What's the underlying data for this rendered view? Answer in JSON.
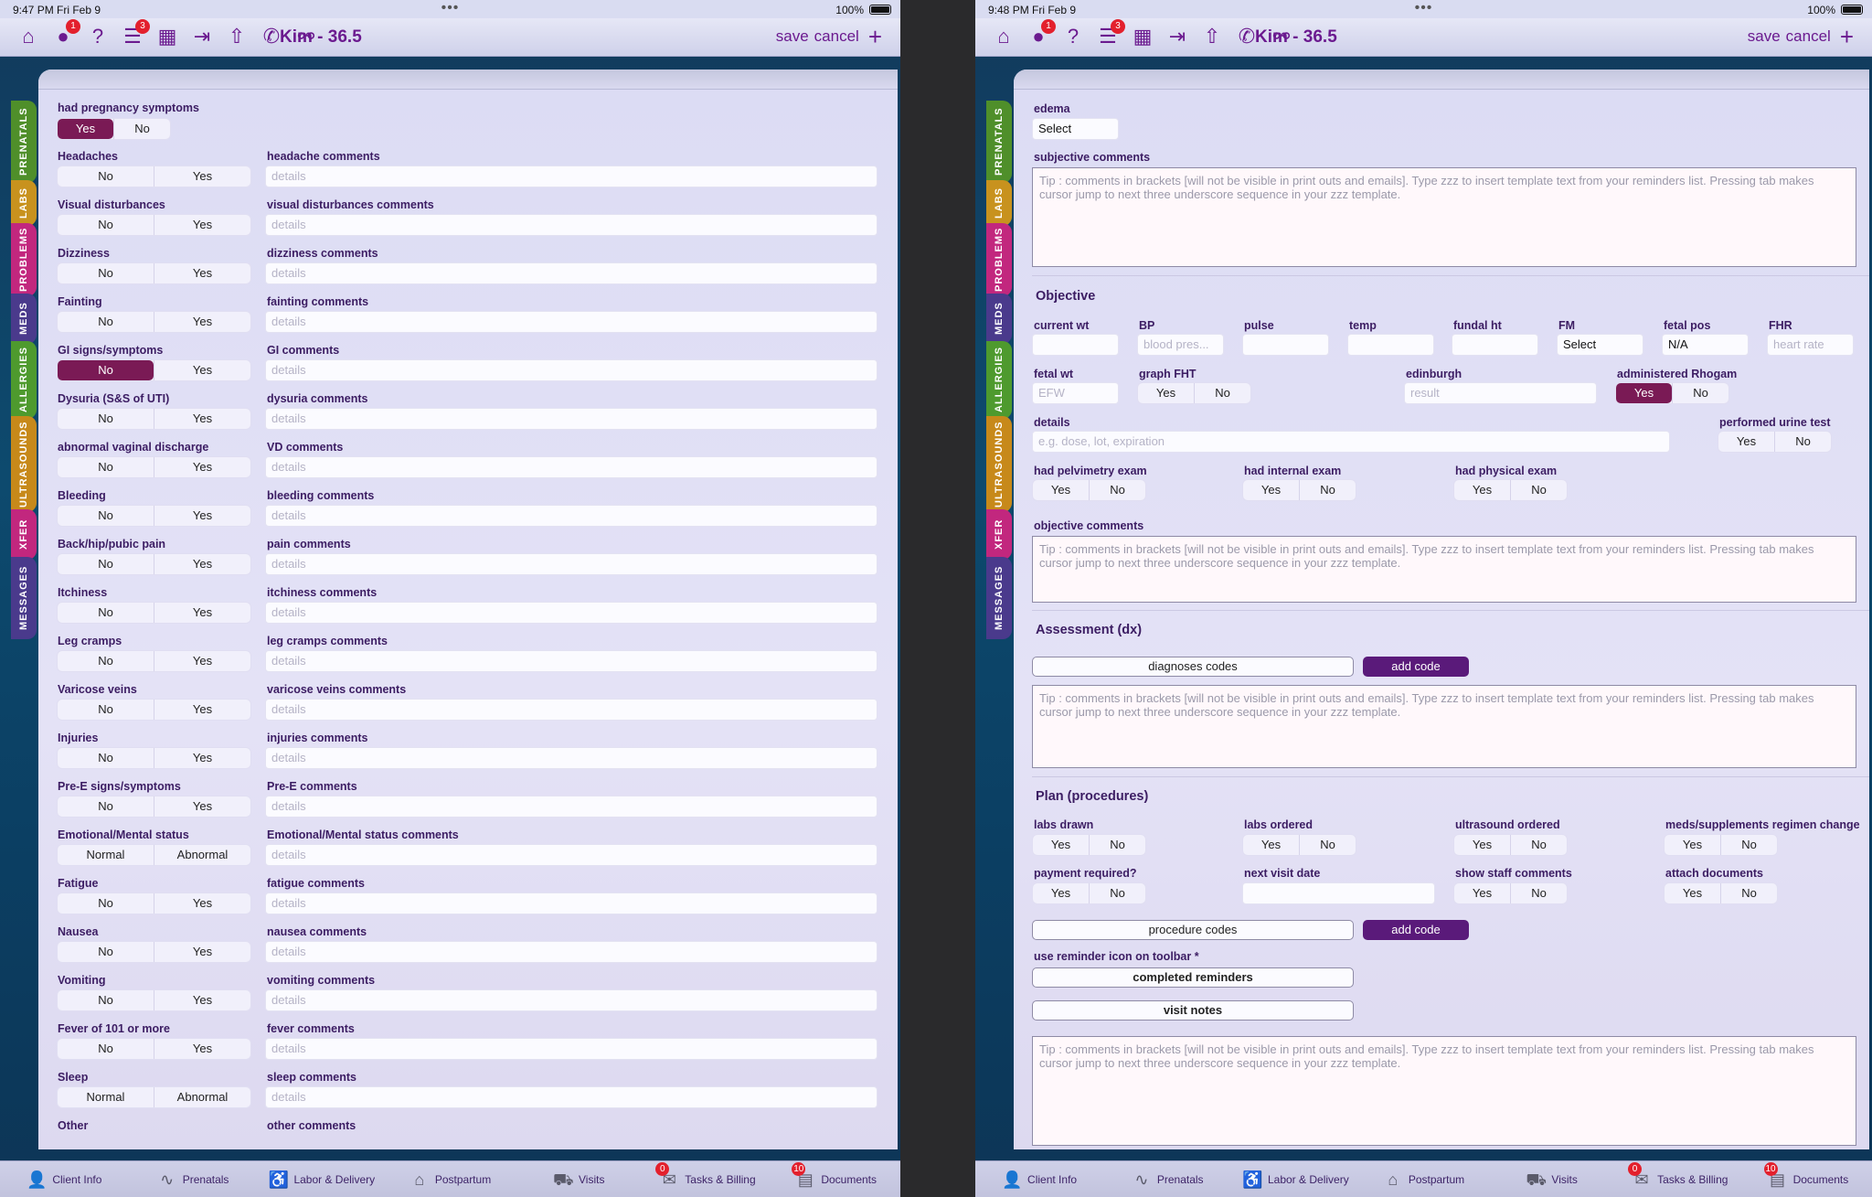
{
  "left": {
    "status": {
      "time": "9:47 PM   Fri Feb 9",
      "battery": "100%"
    },
    "patient": "Kim - 36.5",
    "toolbar": {
      "save": "save",
      "cancel": "cancel",
      "plus": "+"
    },
    "badges": {
      "messages": "1",
      "tasks": "3"
    },
    "first": {
      "label": "had pregnancy symptoms",
      "opt1": "Yes",
      "opt2": "No"
    },
    "rows": [
      {
        "label": "Headaches",
        "a": "No",
        "b": "Yes",
        "comment": "headache comments",
        "ph": "details"
      },
      {
        "label": "Visual disturbances",
        "a": "No",
        "b": "Yes",
        "comment": "visual disturbances comments",
        "ph": "details"
      },
      {
        "label": "Dizziness",
        "a": "No",
        "b": "Yes",
        "comment": "dizziness comments",
        "ph": "details"
      },
      {
        "label": "Fainting",
        "a": "No",
        "b": "Yes",
        "comment": "fainting comments",
        "ph": "details"
      },
      {
        "label": "GI signs/symptoms",
        "a": "No",
        "b": "Yes",
        "comment": "GI comments",
        "ph": "details"
      },
      {
        "label": "Dysuria (S&S of UTI)",
        "a": "No",
        "b": "Yes",
        "comment": "dysuria comments",
        "ph": "details"
      },
      {
        "label": "abnormal vaginal discharge",
        "a": "No",
        "b": "Yes",
        "comment": "VD comments",
        "ph": "details"
      },
      {
        "label": "Bleeding",
        "a": "No",
        "b": "Yes",
        "comment": "bleeding comments",
        "ph": "details"
      },
      {
        "label": "Back/hip/pubic pain",
        "a": "No",
        "b": "Yes",
        "comment": "pain comments",
        "ph": "details"
      },
      {
        "label": "Itchiness",
        "a": "No",
        "b": "Yes",
        "comment": "itchiness comments",
        "ph": "details"
      },
      {
        "label": "Leg cramps",
        "a": "No",
        "b": "Yes",
        "comment": "leg cramps comments",
        "ph": "details"
      },
      {
        "label": "Varicose veins",
        "a": "No",
        "b": "Yes",
        "comment": "varicose veins comments",
        "ph": "details"
      },
      {
        "label": "Injuries",
        "a": "No",
        "b": "Yes",
        "comment": "injuries comments",
        "ph": "details"
      },
      {
        "label": "Pre-E signs/symptoms",
        "a": "No",
        "b": "Yes",
        "comment": "Pre-E comments",
        "ph": "details"
      },
      {
        "label": "Emotional/Mental status",
        "a": "Normal",
        "b": "Abnormal",
        "comment": "Emotional/Mental status comments",
        "ph": "details"
      },
      {
        "label": "Fatigue",
        "a": "No",
        "b": "Yes",
        "comment": "fatigue comments",
        "ph": "details"
      },
      {
        "label": "Nausea",
        "a": "No",
        "b": "Yes",
        "comment": "nausea comments",
        "ph": "details"
      },
      {
        "label": "Vomiting",
        "a": "No",
        "b": "Yes",
        "comment": "vomiting comments",
        "ph": "details"
      },
      {
        "label": "Fever of 101 or more",
        "a": "No",
        "b": "Yes",
        "comment": "fever comments",
        "ph": "details"
      },
      {
        "label": "Sleep",
        "a": "Normal",
        "b": "Abnormal",
        "comment": "sleep comments",
        "ph": "details"
      }
    ],
    "last": {
      "label": "Other",
      "comment": "other comments"
    }
  },
  "right": {
    "status": {
      "time": "9:48 PM   Fri Feb 9",
      "battery": "100%"
    },
    "patient": "Kim - 36.5",
    "toolbar": {
      "save": "save",
      "cancel": "cancel",
      "plus": "+"
    },
    "badges": {
      "messages": "1",
      "tasks": "3"
    },
    "edema": {
      "label": "edema",
      "value": "Select"
    },
    "subjective": {
      "label": "subjective comments",
      "tip": "Tip : comments in brackets [will not be visible in print outs and emails].  Type zzz to insert template text from your reminders list. Pressing tab makes cursor jump to next three underscore sequence in your zzz template."
    },
    "objective": {
      "title": "Objective",
      "current_wt": "current wt",
      "bp": "BP",
      "bp_ph": "blood pres...",
      "pulse": "pulse",
      "temp": "temp",
      "fundal": "fundal ht",
      "fm": "FM",
      "fm_val": "Select",
      "fetal_pos": "fetal pos",
      "fetal_pos_val": "N/A",
      "fhr": "FHR",
      "fhr_ph": "heart rate",
      "fetal_wt": "fetal wt",
      "fetal_wt_ph": "EFW",
      "graph_fht": "graph FHT",
      "edinburgh": "edinburgh",
      "edinburgh_ph": "result",
      "rhogam": "administered Rhogam",
      "details": "details",
      "details_ph": "e.g. dose, lot, expiration",
      "urine": "performed urine test",
      "pelvimetry": "had pelvimetry exam",
      "internal": "had internal exam",
      "physical": "had physical exam",
      "comments": "objective comments",
      "yes": "Yes",
      "no": "No"
    },
    "assessment": {
      "title": "Assessment (dx)",
      "codes": "diagnoses codes",
      "add": "add code"
    },
    "plan": {
      "title": "Plan (procedures)",
      "labs_drawn": "labs drawn",
      "labs_ordered": "labs ordered",
      "us_ordered": "ultrasound ordered",
      "meds": "meds/supplements regimen change",
      "payment": "payment required?",
      "next_visit": "next visit date",
      "staff": "show staff comments",
      "attach": "attach documents",
      "codes": "procedure codes",
      "add": "add code",
      "reminder": "use reminder icon on toolbar *",
      "completed": "completed reminders",
      "visit_notes": "visit notes"
    }
  },
  "sidetabs": [
    "PRENATALS",
    "LABS",
    "PROBLEMS",
    "MEDS",
    "ALLERGIES",
    "ULTRASOUNDS",
    "XFER",
    "MESSAGES"
  ],
  "bottom": [
    {
      "label": "Client Info",
      "icon": "person-icon"
    },
    {
      "label": "Prenatals",
      "icon": "pulse-icon"
    },
    {
      "label": "Labor & Delivery",
      "icon": "stroller-icon"
    },
    {
      "label": "Postpartum",
      "icon": "house-icon"
    },
    {
      "label": "Visits",
      "icon": "car-icon"
    },
    {
      "label": "Tasks & Billing",
      "icon": "tasks-icon",
      "badge": "0"
    },
    {
      "label": "Documents",
      "icon": "documents-icon",
      "badge": "10"
    }
  ],
  "colors": {
    "accent": "#6b1a8f",
    "selected": "#7a1a55",
    "add": "#5a1a7a"
  }
}
